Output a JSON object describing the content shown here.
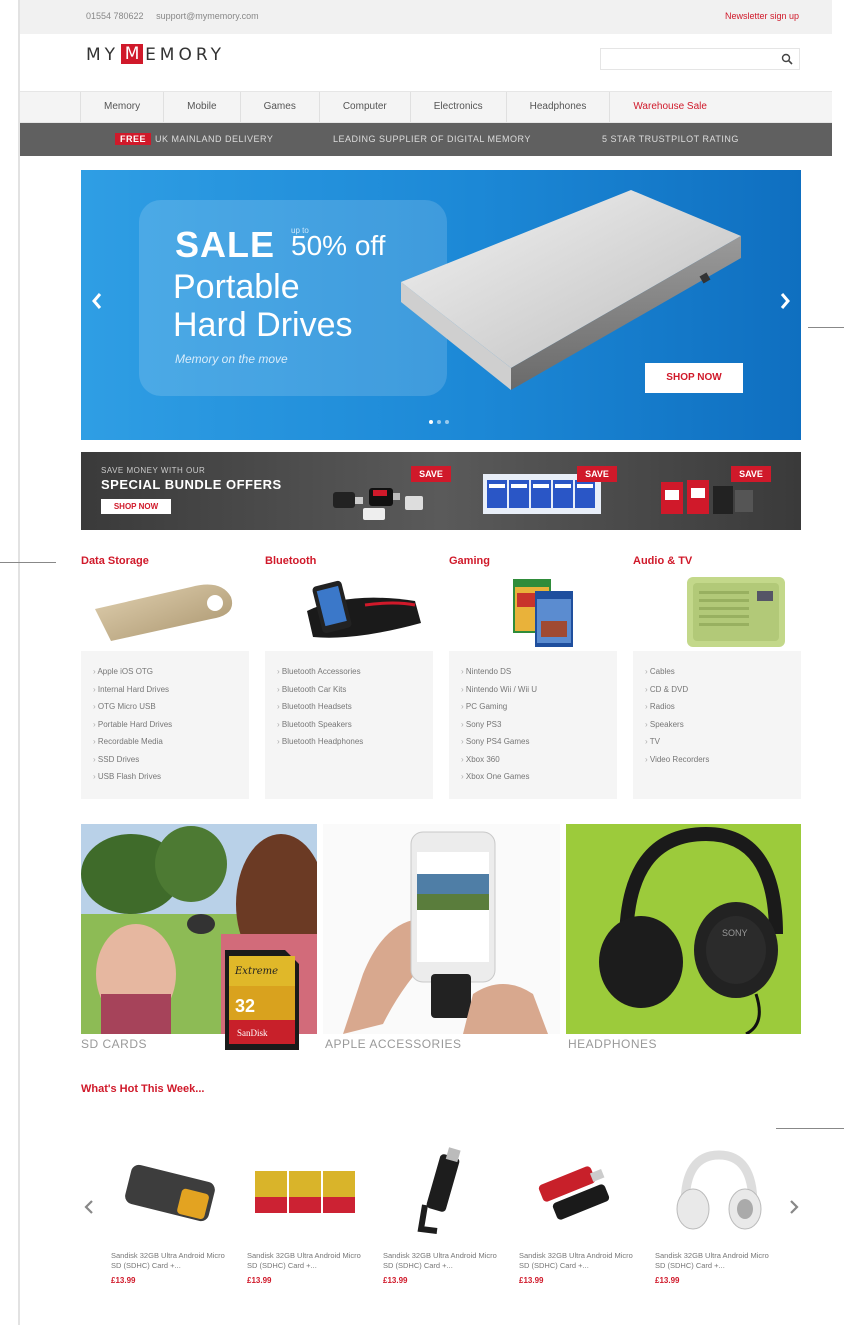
{
  "topbar": {
    "phone": "01554 780622",
    "email": "support@mymemory.com",
    "newsletter": "Newsletter sign up"
  },
  "logo": {
    "before": "MY",
    "mark": "M",
    "after": "EMORY"
  },
  "search": {
    "placeholder": "",
    "icon": "search-icon"
  },
  "nav": [
    {
      "label": "Memory"
    },
    {
      "label": "Mobile"
    },
    {
      "label": "Games"
    },
    {
      "label": "Computer"
    },
    {
      "label": "Electronics"
    },
    {
      "label": "Headphones"
    },
    {
      "label": "Warehouse Sale"
    }
  ],
  "usp": {
    "free_badge": "FREE",
    "delivery": "UK MAINLAND DELIVERY",
    "supplier": "LEADING SUPPLIER OF DIGITAL MEMORY",
    "rating": "5 STAR TRUSTPILOT RATING"
  },
  "hero": {
    "sale": "SALE",
    "upto": "up to",
    "percent": "50% off",
    "line1": "Portable",
    "line2": "Hard Drives",
    "tagline": "Memory on the move",
    "shop": "SHOP NOW",
    "slide_count": 3,
    "active_slide": 1
  },
  "bundle": {
    "line1": "SAVE MONEY WITH OUR",
    "line2": "SPECIAL BUNDLE OFFERS",
    "shop": "SHOP NOW",
    "save1": "SAVE",
    "save2": "SAVE",
    "save3": "SAVE"
  },
  "categories": [
    {
      "title": "Data Storage",
      "items": [
        "Apple iOS OTG",
        "Internal Hard Drives",
        "OTG Micro USB",
        "Portable Hard Drives",
        "Recordable Media",
        "SSD Drives",
        "USB Flash Drives"
      ]
    },
    {
      "title": "Bluetooth",
      "items": [
        "Bluetooth Accessories",
        "Bluetooth Car Kits",
        "Bluetooth Headsets",
        "Bluetooth Speakers",
        "Bluetooth Headphones"
      ]
    },
    {
      "title": "Gaming",
      "items": [
        "Nintendo DS",
        "Nintendo Wii / Wii U",
        "PC Gaming",
        "Sony PS3",
        "Sony PS4 Games",
        "Xbox 360",
        "Xbox One Games"
      ]
    },
    {
      "title": "Audio & TV",
      "items": [
        "Cables",
        "CD & DVD",
        "Radios",
        "Speakers",
        "TV",
        "Video Recorders"
      ]
    }
  ],
  "tiles": {
    "sd": "SD CARDS",
    "apple": "APPLE ACCESSORIES",
    "headphones": "HEADPHONES",
    "sd_card_brand": "Extreme",
    "sd_card_size": "32",
    "sd_card_maker": "SanDisk",
    "headphone_brand": "SONY"
  },
  "hot": {
    "title": "What's Hot This Week...",
    "products": [
      {
        "name": "Sandisk 32GB Ultra Android Micro SD (SDHC) Card +...",
        "price": "£13.99"
      },
      {
        "name": "Sandisk 32GB Ultra Android Micro SD (SDHC) Card +...",
        "price": "£13.99"
      },
      {
        "name": "Sandisk 32GB Ultra Android Micro SD (SDHC) Card +...",
        "price": "£13.99"
      },
      {
        "name": "Sandisk 32GB Ultra Android Micro SD (SDHC) Card +...",
        "price": "£13.99"
      },
      {
        "name": "Sandisk 32GB Ultra Android Micro SD (SDHC) Card +...",
        "price": "£13.99"
      }
    ]
  },
  "colors": {
    "brand_red": "#d0192a",
    "hero_blue": "#1c88d6",
    "usp_grey": "#606060",
    "headphone_green": "#9ccb3b"
  }
}
